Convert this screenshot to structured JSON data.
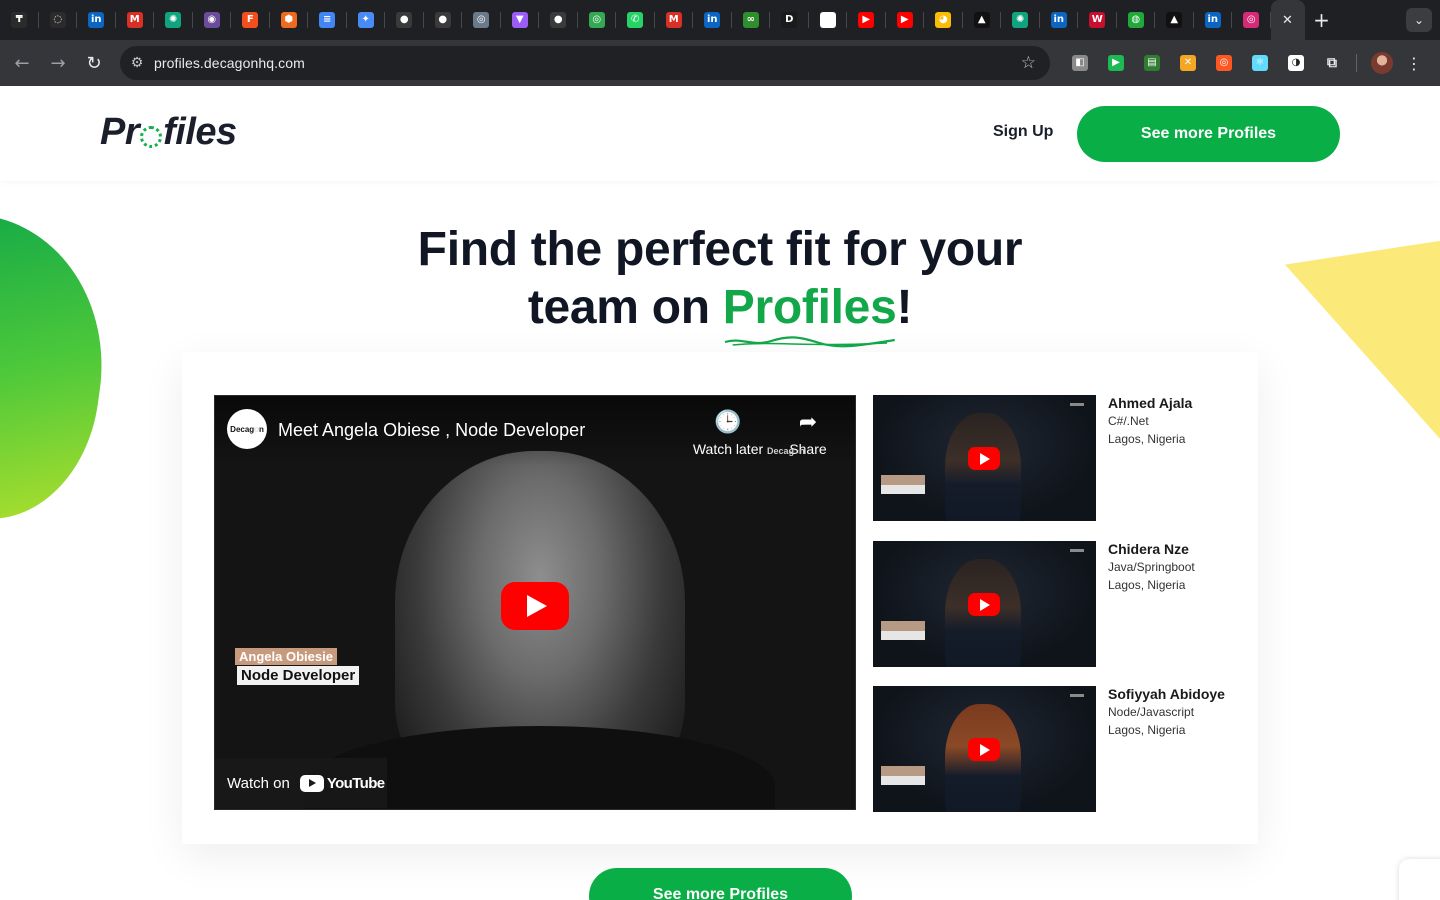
{
  "browser": {
    "tabs": [
      {
        "icon": "threads-icon",
        "glyph": "₸",
        "color": "#2b2b2b"
      },
      {
        "icon": "circle-loading-icon",
        "glyph": "◌",
        "color": "#2b2b2b"
      },
      {
        "icon": "linkedin-icon",
        "glyph": "in",
        "color": "#0a66c2"
      },
      {
        "icon": "gmail-icon",
        "glyph": "M",
        "color": "#d93025"
      },
      {
        "icon": "chatgpt-icon",
        "glyph": "✺",
        "color": "#10a37f"
      },
      {
        "icon": "app-icon",
        "glyph": "◉",
        "color": "#6b4c9a"
      },
      {
        "icon": "figma-icon",
        "glyph": "F",
        "color": "#f24e1e"
      },
      {
        "icon": "package-icon",
        "glyph": "⬢",
        "color": "#f06a1d"
      },
      {
        "icon": "google-docs-icon",
        "glyph": "≡",
        "color": "#4285f4"
      },
      {
        "icon": "gemini-icon",
        "glyph": "✦",
        "color": "#4a8af4"
      },
      {
        "icon": "github-icon",
        "glyph": "●",
        "color": "#3a3a3a"
      },
      {
        "icon": "github-icon",
        "glyph": "●",
        "color": "#3a3a3a"
      },
      {
        "icon": "app-icon",
        "glyph": "◎",
        "color": "#6b7a8a"
      },
      {
        "icon": "vite-icon",
        "glyph": "▼",
        "color": "#9c5cf6"
      },
      {
        "icon": "github-icon",
        "glyph": "●",
        "color": "#3a3a3a"
      },
      {
        "icon": "app-icon",
        "glyph": "◎",
        "color": "#34a853"
      },
      {
        "icon": "whatsapp-icon",
        "glyph": "✆",
        "color": "#25d366"
      },
      {
        "icon": "gmail-icon",
        "glyph": "M",
        "color": "#d93025"
      },
      {
        "icon": "linkedin-icon",
        "glyph": "in",
        "color": "#0a66c2"
      },
      {
        "icon": "app-icon",
        "glyph": "∞",
        "color": "#2f8f2f"
      },
      {
        "icon": "d-icon",
        "glyph": "D",
        "color": "#1a1a1a"
      },
      {
        "icon": "notion-icon",
        "glyph": "N",
        "color": "#ffffff"
      },
      {
        "icon": "youtube-icon",
        "glyph": "▶",
        "color": "#ff0000"
      },
      {
        "icon": "youtube-icon",
        "glyph": "▶",
        "color": "#ff0000"
      },
      {
        "icon": "chrome-icon",
        "glyph": "◕",
        "color": "#fbbc04"
      },
      {
        "icon": "vercel-icon",
        "glyph": "▲",
        "color": "#111111"
      },
      {
        "icon": "chatgpt-icon",
        "glyph": "✺",
        "color": "#10a37f"
      },
      {
        "icon": "linkedin-icon",
        "glyph": "in",
        "color": "#0a66c2"
      },
      {
        "icon": "w-icon",
        "glyph": "W",
        "color": "#c8102e"
      },
      {
        "icon": "globe-icon",
        "glyph": "◍",
        "color": "#22a83a"
      },
      {
        "icon": "vercel-icon",
        "glyph": "▲",
        "color": "#111111"
      },
      {
        "icon": "linkedin-icon",
        "glyph": "in",
        "color": "#0a66c2"
      },
      {
        "icon": "instagram-icon",
        "glyph": "◎",
        "color": "#d62976"
      }
    ],
    "url": "profiles.decagonhq.com",
    "extensions": [
      {
        "icon": "extension-icon",
        "glyph": "◧",
        "color": "#8a8a8a"
      },
      {
        "icon": "extension-icon",
        "glyph": "▶",
        "color": "#1db954"
      },
      {
        "icon": "extension-icon",
        "glyph": "▤",
        "color": "#2e7d32"
      },
      {
        "icon": "extension-icon",
        "glyph": "✕",
        "color": "#f5a623"
      },
      {
        "icon": "extension-icon",
        "glyph": "◎",
        "color": "#ff5722"
      },
      {
        "icon": "react-devtools-icon",
        "glyph": "⚛",
        "color": "#61dafb"
      },
      {
        "icon": "extension-icon",
        "glyph": "◑",
        "color": "#ffffff"
      }
    ]
  },
  "header": {
    "logo_pre": "Pr",
    "logo_post": "files",
    "signup_label": "Sign Up",
    "cta_label": "See more Profiles"
  },
  "hero": {
    "line1": "Find the perfect fit for your",
    "line2_pre": "team on ",
    "line2_accent": "Profiles",
    "line2_post": "!"
  },
  "featured_video": {
    "channel_label": "Decag◌n",
    "title": "Meet Angela Obiese , Node Developer",
    "watch_later_label": "Watch later",
    "share_label": "Share",
    "watermark": "Decag◌n",
    "lower_third_name": "Angela Obiesie",
    "lower_third_role": "Node Developer",
    "watch_on_label": "Watch on",
    "youtube_label": "YouTube"
  },
  "profiles": [
    {
      "name": "Ahmed Ajala",
      "stack": "C#/.Net",
      "location": "Lagos, Nigeria"
    },
    {
      "name": "Chidera Nze",
      "stack": "Java/Springboot",
      "location": "Lagos, Nigeria"
    },
    {
      "name": "Sofiyyah Abidoye",
      "stack": "Node/Javascript",
      "location": "Lagos, Nigeria"
    }
  ],
  "bottom_cta_label": "See more Profiles",
  "colors": {
    "brand_green": "#0aae47",
    "accent_green": "#12a84a",
    "heading": "#101623",
    "yellow_shape": "#fbe97a"
  }
}
